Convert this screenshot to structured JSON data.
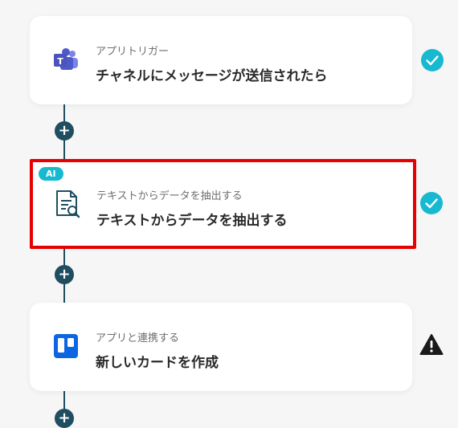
{
  "flow": {
    "steps": [
      {
        "subtitle": "アプリトリガー",
        "title": "チャネルにメッセージが送信されたら",
        "icon": "microsoft-teams-icon",
        "status": "complete"
      },
      {
        "badge": "AI",
        "subtitle": "テキストからデータを抽出する",
        "title": "テキストからデータを抽出する",
        "icon": "document-search-icon",
        "status": "complete",
        "selected": true
      },
      {
        "subtitle": "アプリと連携する",
        "title": "新しいカードを作成",
        "icon": "trello-icon",
        "status": "warning"
      }
    ],
    "add_step_symbol": "+"
  },
  "colors": {
    "connector": "#1f4e61",
    "check": "#17b9d0",
    "warning": "#1a1a1a",
    "selection_border": "#e60000",
    "ai_badge": "#17b9d0"
  }
}
